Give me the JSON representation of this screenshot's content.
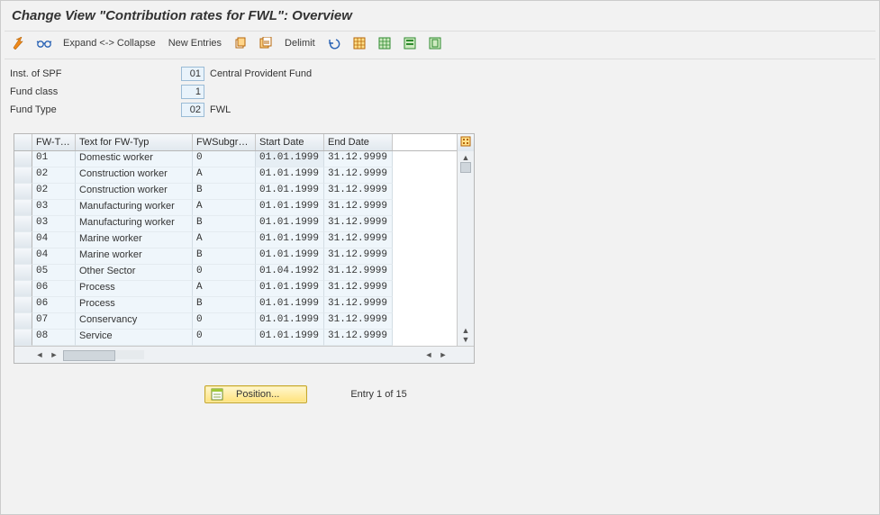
{
  "title": "Change View \"Contribution rates for FWL\": Overview",
  "toolbar": {
    "expand_collapse": "Expand <-> Collapse",
    "new_entries": "New Entries",
    "delimit": "Delimit"
  },
  "header": {
    "inst_spf_label": "Inst. of SPF",
    "inst_spf_value": "01",
    "inst_spf_desc": "Central Provident Fund",
    "fund_class_label": "Fund class",
    "fund_class_value": "1",
    "fund_type_label": "Fund Type",
    "fund_type_value": "02",
    "fund_type_desc": "FWL"
  },
  "table": {
    "columns": {
      "fw_type": "FW-Ty...",
      "text": "Text for FW-Typ",
      "subgroup": "FWSubgru...",
      "start": "Start Date",
      "end": "End Date"
    },
    "rows": [
      {
        "fwtype": "01",
        "text": "Domestic worker",
        "sub": "0",
        "start": "01.01.1999",
        "end": "31.12.9999"
      },
      {
        "fwtype": "02",
        "text": "Construction worker",
        "sub": "A",
        "start": "01.01.1999",
        "end": "31.12.9999"
      },
      {
        "fwtype": "02",
        "text": "Construction worker",
        "sub": "B",
        "start": "01.01.1999",
        "end": "31.12.9999"
      },
      {
        "fwtype": "03",
        "text": "Manufacturing worker",
        "sub": "A",
        "start": "01.01.1999",
        "end": "31.12.9999"
      },
      {
        "fwtype": "03",
        "text": "Manufacturing worker",
        "sub": "B",
        "start": "01.01.1999",
        "end": "31.12.9999"
      },
      {
        "fwtype": "04",
        "text": "Marine worker",
        "sub": "A",
        "start": "01.01.1999",
        "end": "31.12.9999"
      },
      {
        "fwtype": "04",
        "text": "Marine worker",
        "sub": "B",
        "start": "01.01.1999",
        "end": "31.12.9999"
      },
      {
        "fwtype": "05",
        "text": "Other Sector",
        "sub": "0",
        "start": "01.04.1992",
        "end": "31.12.9999"
      },
      {
        "fwtype": "06",
        "text": "Process",
        "sub": "A",
        "start": "01.01.1999",
        "end": "31.12.9999"
      },
      {
        "fwtype": "06",
        "text": "Process",
        "sub": "B",
        "start": "01.01.1999",
        "end": "31.12.9999"
      },
      {
        "fwtype": "07",
        "text": "Conservancy",
        "sub": "0",
        "start": "01.01.1999",
        "end": "31.12.9999"
      },
      {
        "fwtype": "08",
        "text": "Service",
        "sub": "0",
        "start": "01.01.1999",
        "end": "31.12.9999"
      }
    ]
  },
  "footer": {
    "position_label": "Position...",
    "entry_text": "Entry 1 of 15"
  },
  "colors": {
    "accent": "#e9f3fb",
    "toolbar_icon_orange": "#f0891b",
    "toolbar_icon_green": "#2e8a2e"
  }
}
